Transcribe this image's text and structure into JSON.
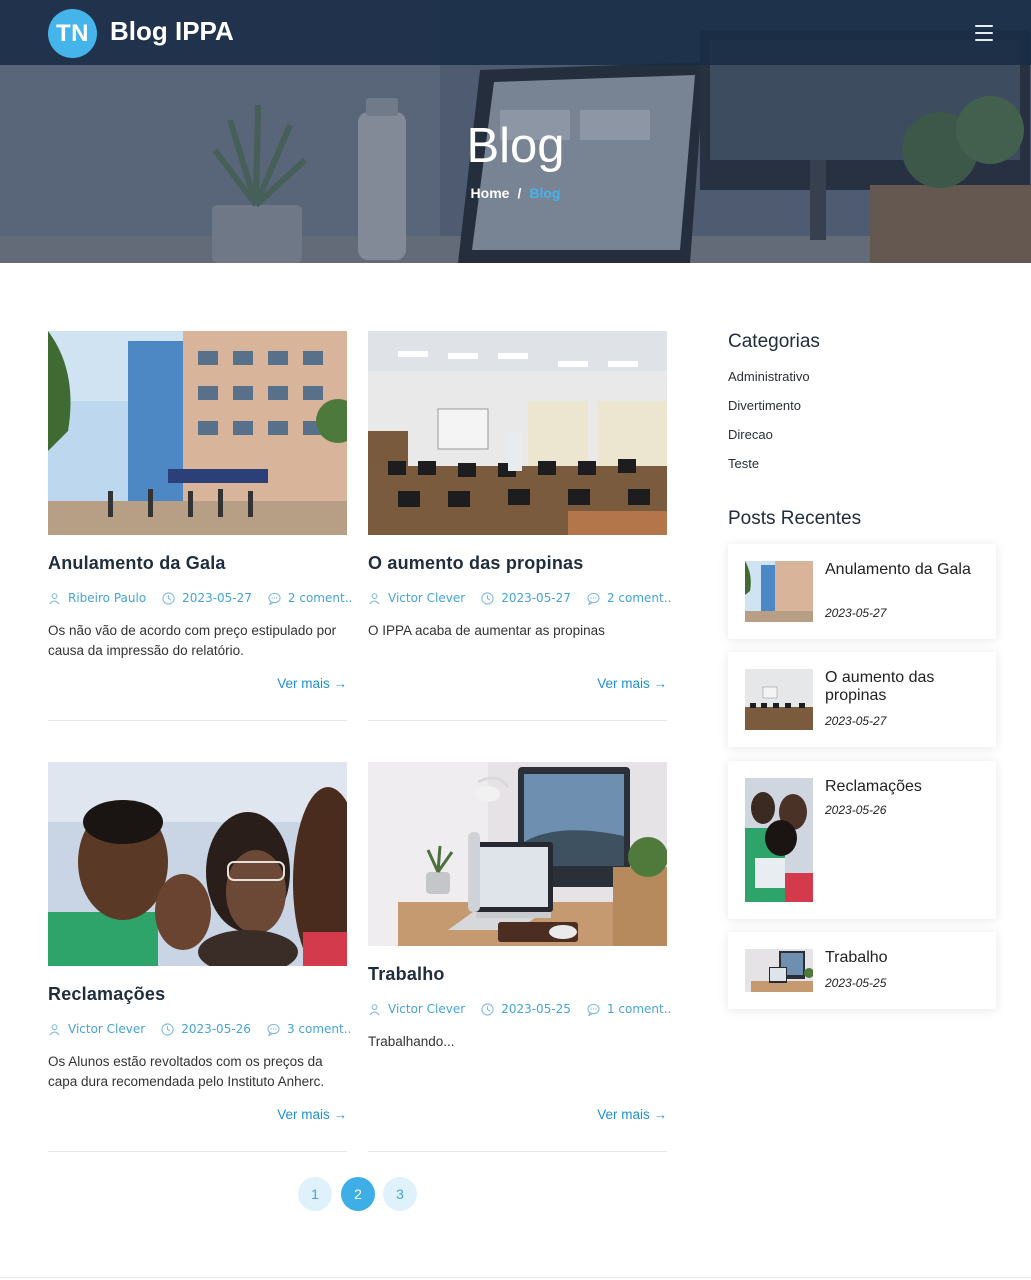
{
  "header": {
    "logo_text": "TN",
    "brand": "Blog IPPA"
  },
  "hero": {
    "title": "Blog",
    "breadcrumb_home": "Home",
    "breadcrumb_sep": "/",
    "breadcrumb_current": "Blog"
  },
  "posts": [
    {
      "title": "Anulamento da Gala",
      "author": "Ribeiro Paulo",
      "date": "2023-05-27",
      "comments": "2 coment..",
      "excerpt": "Os não vão de acordo com preço estipulado por causa da impressão do relatório.",
      "read_more": "Ver mais →"
    },
    {
      "title": "O aumento das propinas",
      "author": "Victor Clever",
      "date": "2023-05-27",
      "comments": "2 coment..",
      "excerpt": "O IPPA acaba de aumentar as propinas",
      "read_more": "Ver mais →"
    },
    {
      "title": "Reclamações",
      "author": "Victor Clever",
      "date": "2023-05-26",
      "comments": "3 coment..",
      "excerpt": "Os Alunos estão revoltados com os preços da capa dura recomendada pelo Instituto Anherc.",
      "read_more": "Ver mais →"
    },
    {
      "title": "Trabalho",
      "author": "Victor Clever",
      "date": "2023-05-25",
      "comments": "1 coment..",
      "excerpt": "Trabalhando...",
      "read_more": "Ver mais →"
    }
  ],
  "pagination": {
    "pages": [
      "1",
      "2",
      "3"
    ],
    "current": "2"
  },
  "sidebar": {
    "categories_title": "Categorias",
    "categories": [
      "Administrativo",
      "Divertimento",
      "Direcao",
      "Teste"
    ],
    "recent_title": "Posts Recentes",
    "recent": [
      {
        "title": "Anulamento da Gala",
        "date": "2023-05-27"
      },
      {
        "title": "O aumento das propinas",
        "date": "2023-05-27"
      },
      {
        "title": "Reclamações",
        "date": "2023-05-26"
      },
      {
        "title": "Trabalho",
        "date": "2023-05-25"
      }
    ]
  },
  "icons": {
    "author": "user-icon",
    "date": "clock-icon",
    "comments": "comment-icon",
    "menu": "hamburger-menu-icon"
  },
  "colors": {
    "accent": "#45b4ea",
    "link": "#1f8fcf",
    "navbar": "#192c46"
  }
}
